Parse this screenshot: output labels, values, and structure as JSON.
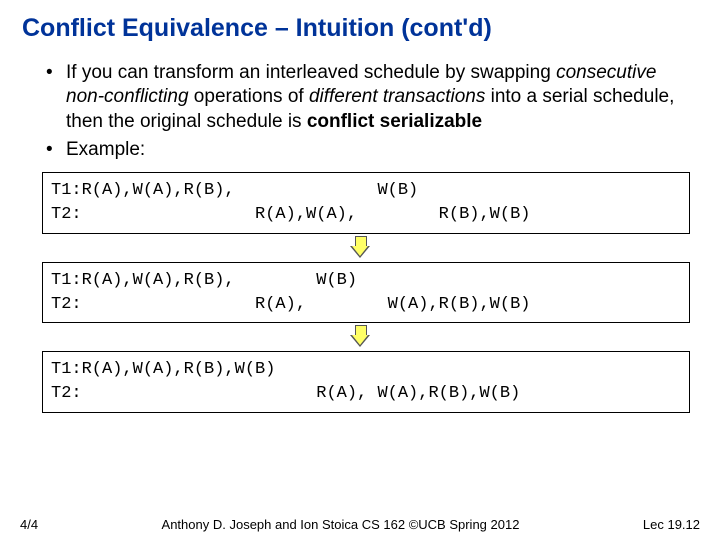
{
  "title": "Conflict Equivalence – Intuition  (cont'd)",
  "bullets": {
    "b1a": "If you can transform an interleaved schedule by swapping ",
    "b1b": "consecutive non-conflicting",
    "b1c": " operations of ",
    "b1d": "different transactions",
    "b1e": " into a serial schedule, then the original schedule is ",
    "b1f": "conflict serializable",
    "b2": "Example:"
  },
  "box1": {
    "l1": "T1:R(A),W(A),R(B),              W(B)",
    "l2": "T2:                 R(A),W(A),        R(B),W(B)"
  },
  "box2": {
    "l1": "T1:R(A),W(A),R(B),        W(B)",
    "l2": "T2:                 R(A),        W(A),R(B),W(B)"
  },
  "box3": {
    "l1": "T1:R(A),W(A),R(B),W(B)",
    "l2": "T2:                       R(A), W(A),R(B),W(B)"
  },
  "footer": {
    "left": "4/4",
    "center": "Anthony D. Joseph and Ion Stoica CS 162 ©UCB Spring 2012",
    "right": "Lec 19.12"
  }
}
